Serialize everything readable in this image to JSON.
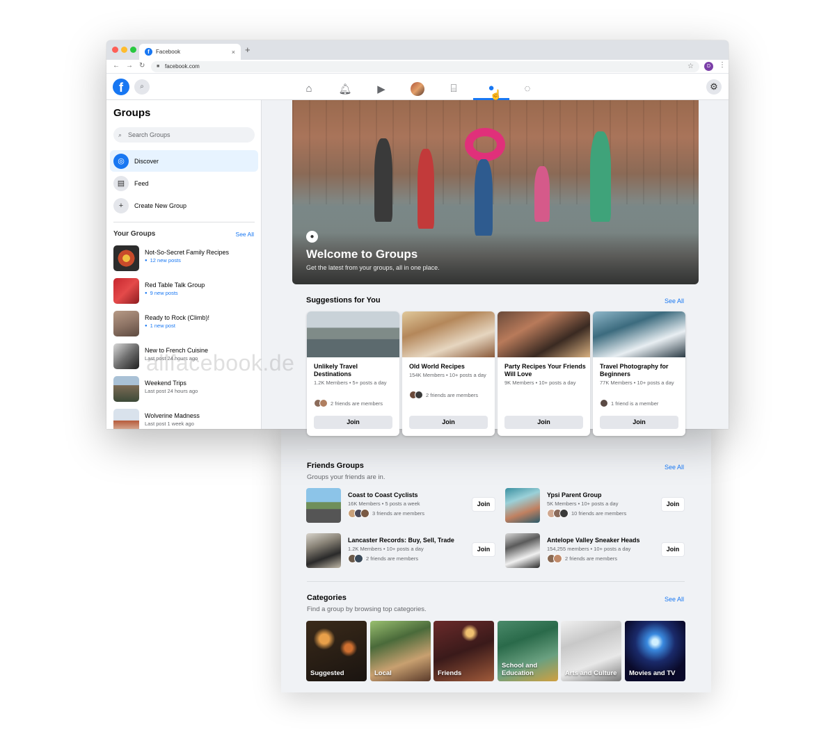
{
  "browser": {
    "tab_title": "Facebook",
    "tab_close": "×",
    "new_tab": "+",
    "url": "facebook.com",
    "profile_initial": "D",
    "back": "←",
    "forward": "→",
    "reload": "↻",
    "star": "☆",
    "menu": "⋮",
    "lock": "🔒"
  },
  "header": {
    "logo": "f",
    "nav_icons": [
      "home-icon",
      "notifications-icon",
      "watch-icon",
      "profile-avatar",
      "marketplace-icon",
      "groups-icon",
      "messenger-icon"
    ],
    "active_nav": "groups-icon",
    "colors": {
      "brand": "#1877f2",
      "background": "#f0f2f5"
    }
  },
  "sidebar": {
    "title": "Groups",
    "search_placeholder": "Search Groups",
    "items": [
      {
        "label": "Discover",
        "icon": "discover-icon",
        "active": true
      },
      {
        "label": "Feed",
        "icon": "feed-icon",
        "active": false
      },
      {
        "label": "Create New Group",
        "icon": "plus-icon",
        "active": false
      }
    ],
    "your_groups_label": "Your Groups",
    "see_all": "See All",
    "your_groups": [
      {
        "name": "Not-So-Secret Family Recipes",
        "meta": "12 new posts",
        "new": true
      },
      {
        "name": "Red Table Talk Group",
        "meta": "9 new posts",
        "new": true
      },
      {
        "name": "Ready to Rock (Climb)!",
        "meta": "1 new post",
        "new": true
      },
      {
        "name": "New to French Cuisine",
        "meta": "Last post 24 hours ago",
        "new": false
      },
      {
        "name": "Weekend Trips",
        "meta": "Last post 24 hours ago",
        "new": false
      },
      {
        "name": "Wolverine Madness",
        "meta": "Last post 1 week ago",
        "new": false
      }
    ]
  },
  "hero": {
    "title": "Welcome to Groups",
    "subtitle": "Get the latest from your groups, all in one place."
  },
  "suggestions": {
    "title": "Suggestions for You",
    "see_all": "See All",
    "cards": [
      {
        "title": "Unlikely Travel Destinations",
        "meta": "1.2K Members • 5+ posts a day",
        "friends": "2 friends are members",
        "join": "Join"
      },
      {
        "title": "Old World Recipes",
        "meta": "154K Members • 10+ posts a day",
        "friends": "2 friends are members",
        "join": "Join"
      },
      {
        "title": "Party Recipes Your Friends Will Love",
        "meta": "9K Members • 10+ posts a day",
        "friends": "",
        "join": "Join"
      },
      {
        "title": "Travel Photography for Beginners",
        "meta": "77K Members • 10+ posts a day",
        "friends": "1 friend is a member",
        "join": "Join"
      }
    ]
  },
  "friends_groups": {
    "title": "Friends Groups",
    "subtitle": "Groups your friends are in.",
    "see_all": "See All",
    "groups": [
      {
        "name": "Coast to Coast Cyclists",
        "meta": "16K Members • 5 posts a week",
        "friends": "3 friends are members",
        "join": "Join"
      },
      {
        "name": "Ypsi Parent Group",
        "meta": "5K Members • 10+ posts a day",
        "friends": "10 friends are members",
        "join": "Join"
      },
      {
        "name": "Lancaster Records: Buy, Sell, Trade",
        "meta": "1.2K Members • 10+ posts a day",
        "friends": "2 friends are members",
        "join": "Join"
      },
      {
        "name": "Antelope Valley Sneaker Heads",
        "meta": "154,255 members • 10+ posts a day",
        "friends": "2 friends are members",
        "join": "Join"
      }
    ]
  },
  "categories": {
    "title": "Categories",
    "subtitle": "Find a group by browsing top categories.",
    "see_all": "See All",
    "items": [
      "Suggested",
      "Local",
      "Friends",
      "School and Education",
      "Arts and Culture",
      "Movies and TV"
    ]
  },
  "watermark": "allfacebook.de"
}
